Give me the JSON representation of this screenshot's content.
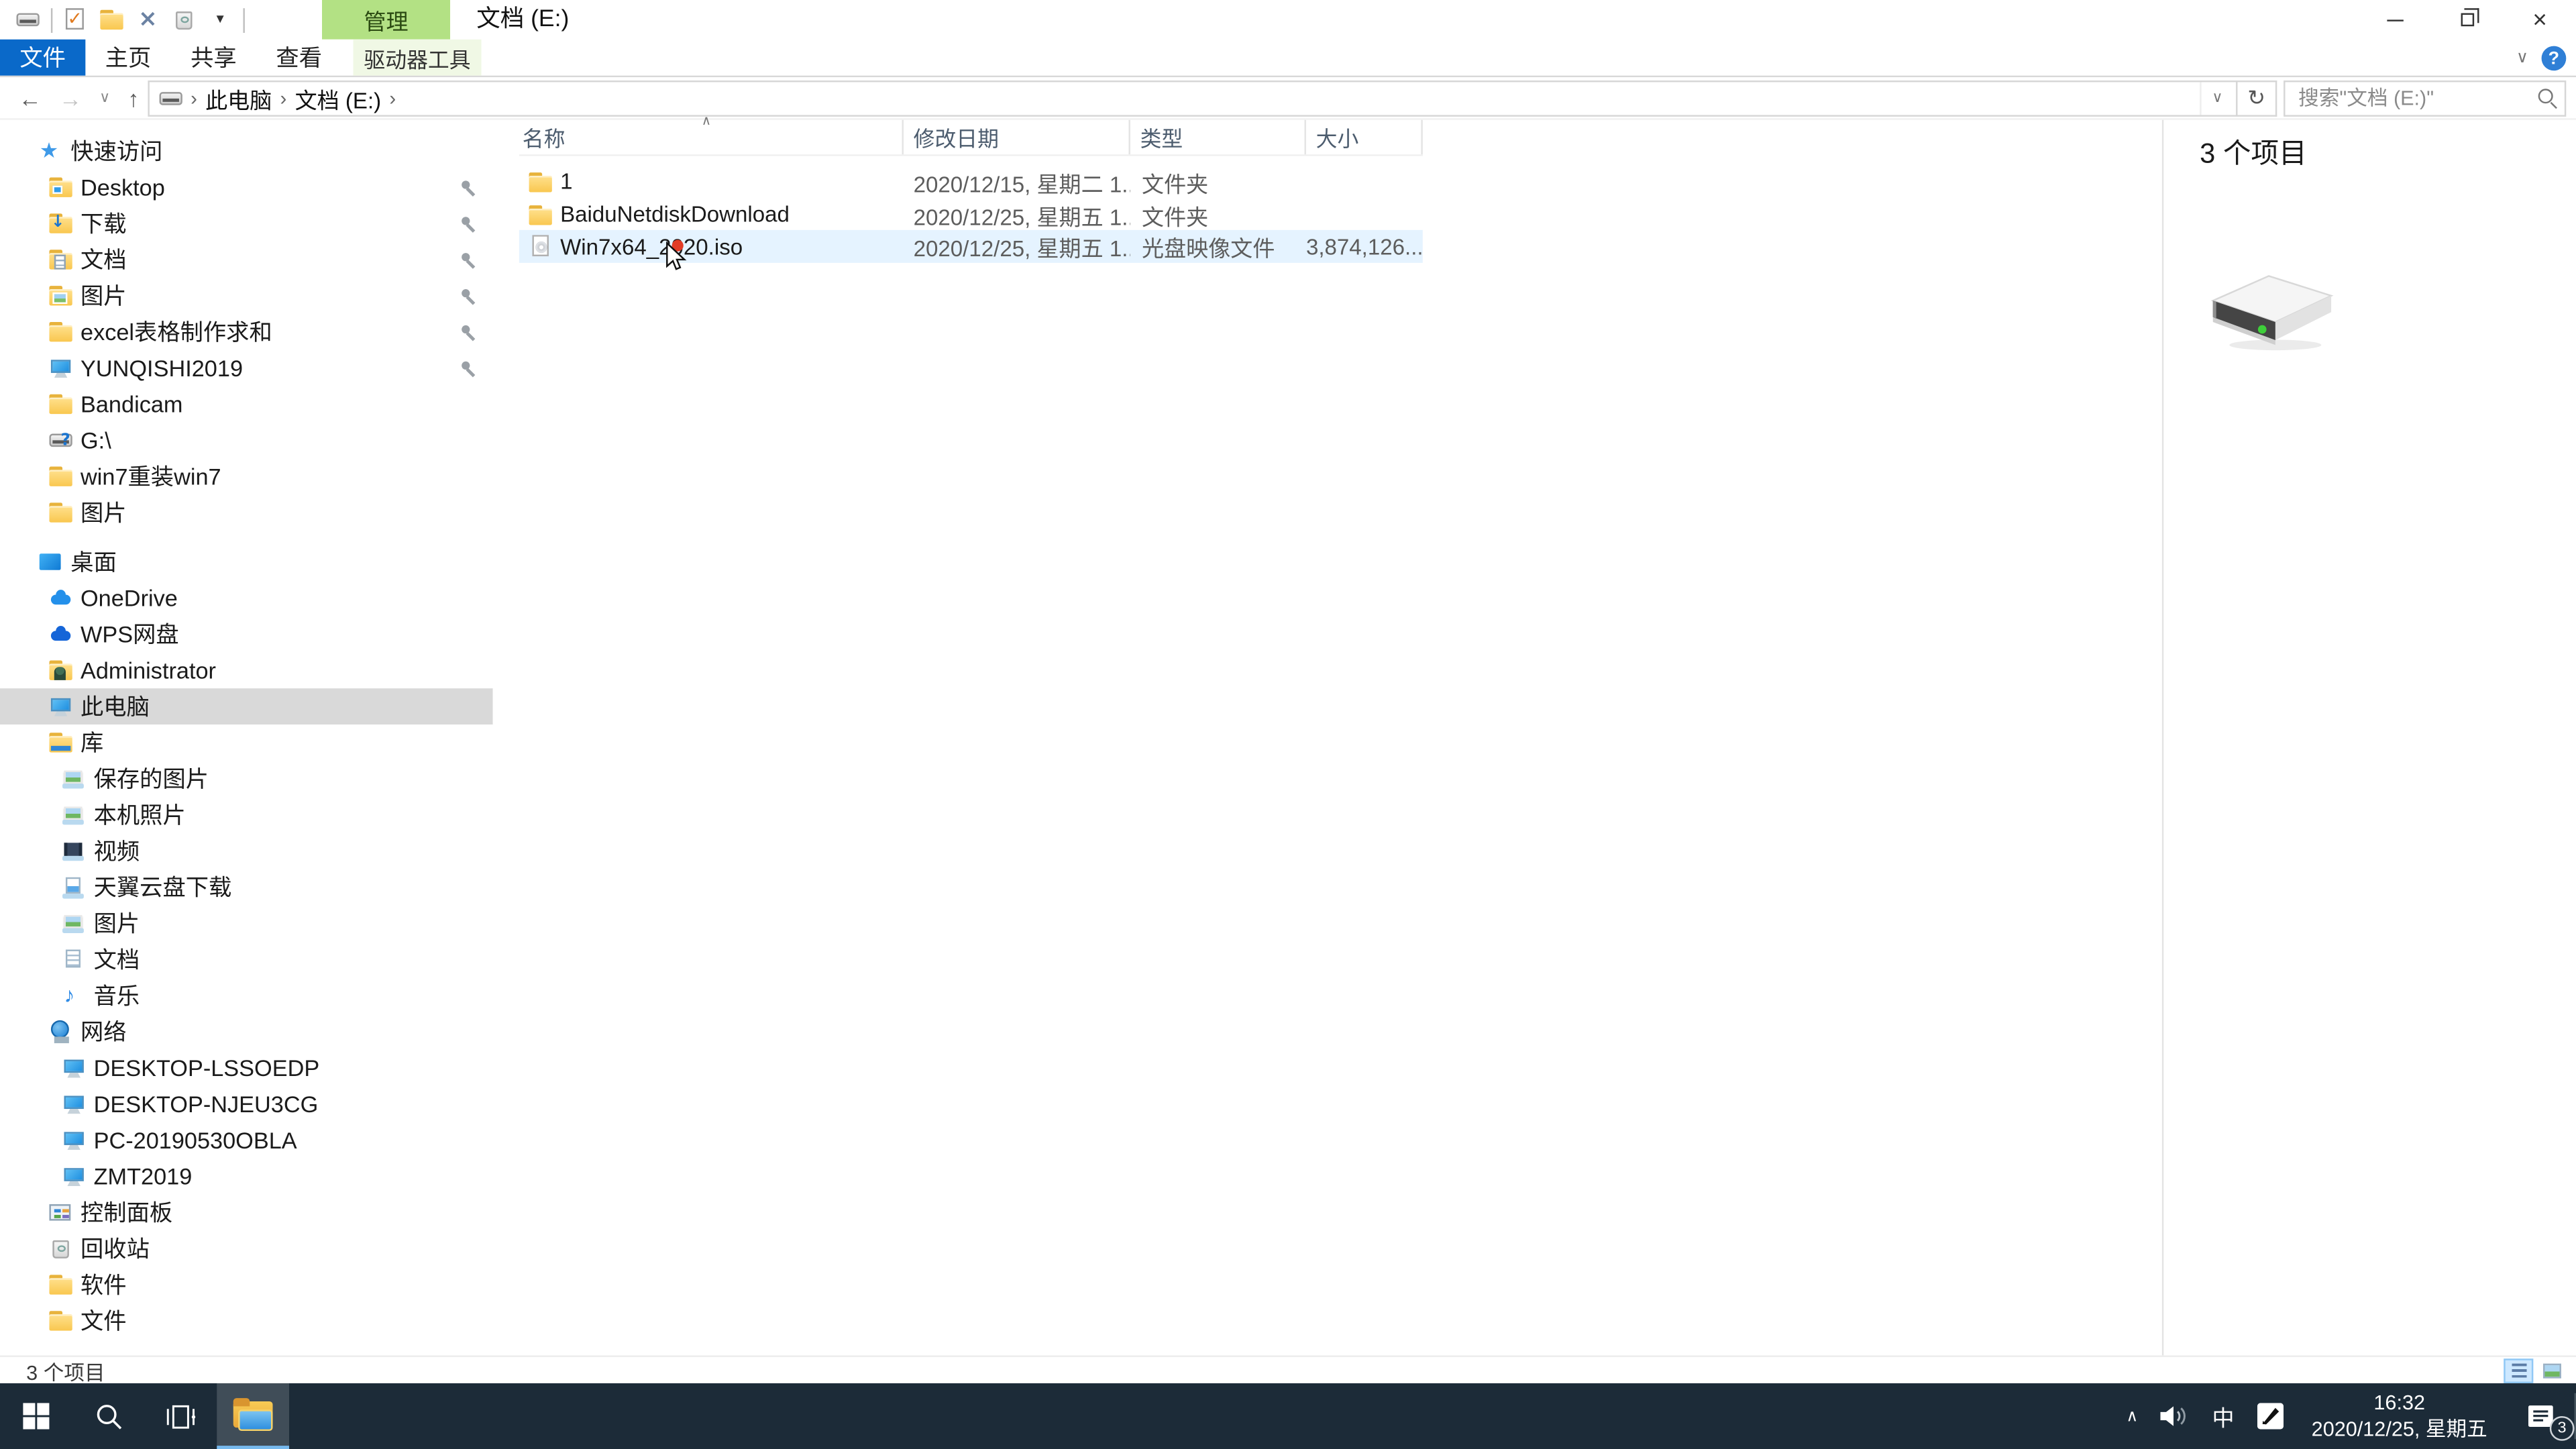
{
  "titlebar": {
    "contextual_tab": "管理",
    "title": "文档 (E:)",
    "qat": [
      {
        "id": "window-icon",
        "icon": "drive",
        "sep_after": true
      },
      {
        "id": "properties",
        "icon": "check-doc"
      },
      {
        "id": "new-folder",
        "icon": "folder"
      },
      {
        "id": "delete",
        "icon": "delete-x"
      },
      {
        "id": "recycle-bin",
        "icon": "recycle-bin"
      },
      {
        "id": "customize",
        "icon": "dropdown",
        "sep_after": true
      }
    ]
  },
  "ribbon": {
    "file_tab": "文件",
    "tabs": [
      {
        "id": "home",
        "label": "主页"
      },
      {
        "id": "share",
        "label": "共享"
      },
      {
        "id": "view",
        "label": "查看"
      }
    ],
    "tool_tab": "驱动器工具",
    "help_label": "?"
  },
  "navbar": {
    "breadcrumb": [
      "此电脑",
      "文档 (E:)"
    ],
    "search_placeholder": "搜索\"文档 (E:)\""
  },
  "sidebar": {
    "items": [
      {
        "id": "quick-access",
        "label": "快速访问",
        "icon": "star",
        "depth": 0
      },
      {
        "id": "desktop-pinned",
        "label": "Desktop",
        "icon": "folder-desktop",
        "depth": 1,
        "pinned": true
      },
      {
        "id": "downloads",
        "label": "下载",
        "icon": "folder-down",
        "depth": 1,
        "pinned": true
      },
      {
        "id": "documents",
        "label": "文档",
        "icon": "folder-doc",
        "depth": 1,
        "pinned": true
      },
      {
        "id": "pictures",
        "label": "图片",
        "icon": "folder-pic",
        "depth": 1,
        "pinned": true
      },
      {
        "id": "excel-folder",
        "label": "excel表格制作求和",
        "icon": "folder",
        "depth": 1,
        "pinned": true
      },
      {
        "id": "yunqishi2019",
        "label": "YUNQISHI2019",
        "icon": "monitor",
        "depth": 1,
        "pinned": true
      },
      {
        "id": "bandicam",
        "label": "Bandicam",
        "icon": "folder",
        "depth": 1
      },
      {
        "id": "g-drive",
        "label": "G:\\",
        "icon": "drive-question",
        "depth": 1
      },
      {
        "id": "win7-folder",
        "label": "win7重装win7",
        "icon": "folder",
        "depth": 1
      },
      {
        "id": "pictures-2",
        "label": "图片",
        "icon": "folder",
        "depth": 1
      },
      {
        "id": "desktop-root",
        "label": "桌面",
        "icon": "desktop",
        "depth": 0,
        "gap": true
      },
      {
        "id": "onedrive",
        "label": "OneDrive",
        "icon": "onedrive-cloud",
        "depth": 1
      },
      {
        "id": "wps-cloud",
        "label": "WPS网盘",
        "icon": "wps-cloud",
        "depth": 1
      },
      {
        "id": "administrator",
        "label": "Administrator",
        "icon": "user-folder",
        "depth": 1
      },
      {
        "id": "this-pc",
        "label": "此电脑",
        "icon": "monitor",
        "depth": 1,
        "selected": true
      },
      {
        "id": "libraries",
        "label": "库",
        "icon": "library",
        "depth": 1
      },
      {
        "id": "saved-pictures",
        "label": "保存的图片",
        "icon": "library-pictures",
        "depth": 2
      },
      {
        "id": "camera-roll",
        "label": "本机照片",
        "icon": "library-pictures",
        "depth": 2
      },
      {
        "id": "videos",
        "label": "视频",
        "icon": "library-video",
        "depth": 2
      },
      {
        "id": "tianyi-cloud-download",
        "label": "天翼云盘下载",
        "icon": "library-download",
        "depth": 2
      },
      {
        "id": "lib-pictures",
        "label": "图片",
        "icon": "library-pictures",
        "depth": 2
      },
      {
        "id": "lib-documents",
        "label": "文档",
        "icon": "library-doc",
        "depth": 2
      },
      {
        "id": "music",
        "label": "音乐",
        "icon": "library-music",
        "depth": 2
      },
      {
        "id": "network",
        "label": "网络",
        "icon": "network",
        "depth": 1
      },
      {
        "id": "desktop-lssoedp",
        "label": "DESKTOP-LSSOEDP",
        "icon": "monitor",
        "depth": 2
      },
      {
        "id": "desktop-njeu3cg",
        "label": "DESKTOP-NJEU3CG",
        "icon": "monitor",
        "depth": 2
      },
      {
        "id": "pc-20190530obla",
        "label": "PC-20190530OBLA",
        "icon": "monitor",
        "depth": 2
      },
      {
        "id": "zmt2019",
        "label": "ZMT2019",
        "icon": "monitor",
        "depth": 2
      },
      {
        "id": "control-panel",
        "label": "控制面板",
        "icon": "control-panel",
        "depth": 1
      },
      {
        "id": "recycle-bin",
        "label": "回收站",
        "icon": "recycle-bin",
        "depth": 1
      },
      {
        "id": "software",
        "label": "软件",
        "icon": "folder",
        "depth": 1
      },
      {
        "id": "files",
        "label": "文件",
        "icon": "folder",
        "depth": 1
      }
    ]
  },
  "files": {
    "columns": [
      {
        "id": "name",
        "label": "名称"
      },
      {
        "id": "date-modified",
        "label": "修改日期"
      },
      {
        "id": "type",
        "label": "类型"
      },
      {
        "id": "size",
        "label": "大小"
      }
    ],
    "sort_column": "name",
    "rows": [
      {
        "id": "folder-1",
        "name": "1",
        "icon": "folder",
        "date": "2020/12/15, 星期二 1...",
        "type": "文件夹",
        "size": ""
      },
      {
        "id": "baidunetdiskdownload",
        "name": "BaiduNetdiskDownload",
        "icon": "folder",
        "date": "2020/12/25, 星期五 1...",
        "type": "文件夹",
        "size": ""
      },
      {
        "id": "win7x64-2020-iso",
        "name": "Win7x64_2020.iso",
        "icon": "iso-file",
        "date": "2020/12/25, 星期五 1...",
        "type": "光盘映像文件",
        "size": "3,874,126...",
        "hovered": true
      }
    ]
  },
  "preview": {
    "count_label": "3 个项目"
  },
  "statusbar": {
    "count_label": "3 个项目"
  },
  "taskbar": {
    "ime": "中",
    "time": "16:32",
    "date": "2020/12/25, 星期五",
    "notification_badge": "3"
  }
}
